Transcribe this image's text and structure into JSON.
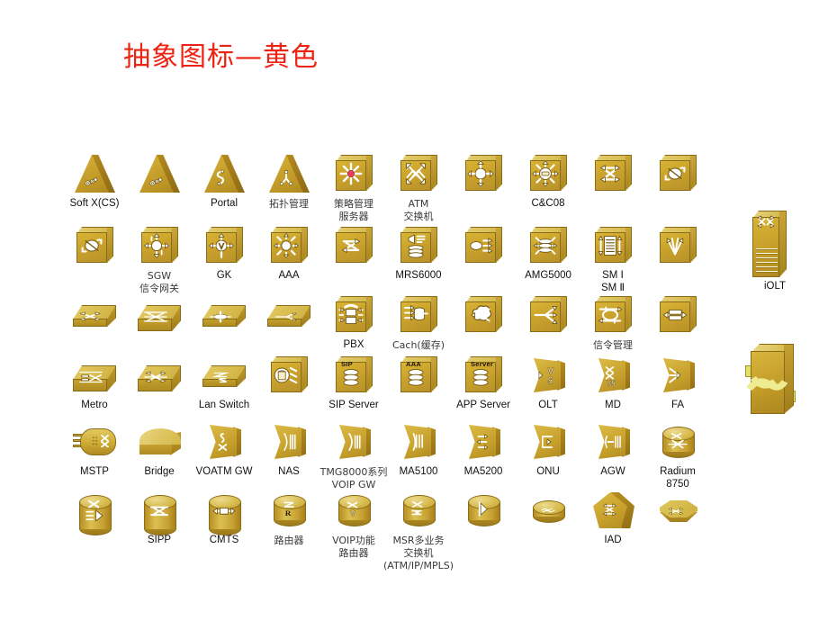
{
  "slide": {
    "title": "抽象图标—黄色",
    "title_color": "#ee2211",
    "background": "#ffffff",
    "palette": {
      "gold_front": "#c8a02b",
      "gold_top": "#e0c85d",
      "gold_side": "#a8811c",
      "outline": "#8a6b18",
      "glyph_white": "#ffffff",
      "accent_pink": "#e8405a",
      "label_text": "#111111"
    }
  },
  "rows": [
    {
      "name": "row-1",
      "icons": [
        {
          "label": "Soft X(CS)",
          "shape": "triangle",
          "glyph": "gears-triangle-icon",
          "cjk": false
        },
        {
          "label": "",
          "shape": "triangle",
          "glyph": "gears-triangle-icon",
          "cjk": false
        },
        {
          "label": "Portal",
          "shape": "triangle",
          "glyph": "portal-s-curve-icon",
          "cjk": false
        },
        {
          "label": "拓扑管理",
          "shape": "triangle",
          "glyph": "topology-tri-node-icon",
          "cjk": true
        },
        {
          "label": "策略管理\n服务器",
          "shape": "cube",
          "glyph": "policy-starburst-icon",
          "cjk": true
        },
        {
          "label": "ATM\n交换机",
          "shape": "cube",
          "glyph": "atm-cross-arrows-icon",
          "cjk": true
        },
        {
          "label": "",
          "shape": "cube",
          "glyph": "ring-four-arrows-icon",
          "cjk": false
        },
        {
          "label": "C&C08",
          "shape": "cube",
          "glyph": "switch-core-arrows-icon",
          "cjk": false
        },
        {
          "label": "",
          "shape": "cube",
          "glyph": "cross-flow-arrows-icon",
          "cjk": false
        },
        {
          "label": "",
          "shape": "cube",
          "glyph": "loop-arrow-icon",
          "cjk": false
        }
      ]
    },
    {
      "name": "row-2",
      "icons": [
        {
          "label": "",
          "shape": "cube",
          "glyph": "loop-arrow-icon",
          "cjk": false
        },
        {
          "label": "SGW\n信令网关",
          "shape": "cube",
          "glyph": "gateway-ring-arrows-icon",
          "cjk": true
        },
        {
          "label": "GK",
          "shape": "cube",
          "glyph": "gatekeeper-v-arrows-icon",
          "cjk": false
        },
        {
          "label": "AAA",
          "shape": "cube",
          "glyph": "aaa-sunburst-icon",
          "cjk": false
        },
        {
          "label": "",
          "shape": "cube",
          "glyph": "double-arrow-exchange-icon",
          "cjk": false
        },
        {
          "label": "MRS6000",
          "shape": "cube",
          "glyph": "media-stack-icon",
          "cjk": false
        },
        {
          "label": "",
          "shape": "cube",
          "glyph": "oval-lines-icon",
          "cjk": false
        },
        {
          "label": "AMG5000",
          "shape": "cube",
          "glyph": "disk-stack-arrows-icon",
          "cjk": false
        },
        {
          "label": "SM Ⅰ\nSM Ⅱ",
          "shape": "cube",
          "glyph": "shelf-module-icon",
          "cjk": false
        },
        {
          "label": "",
          "shape": "cube",
          "glyph": "fan-out-lines-icon",
          "cjk": false
        }
      ]
    },
    {
      "name": "row-3",
      "icons": [
        {
          "label": "",
          "shape": "slab",
          "glyph": "cross-switch-icon",
          "cjk": false
        },
        {
          "label": "",
          "shape": "slab2",
          "glyph": "multi-cross-switch-icon",
          "cjk": false
        },
        {
          "label": "",
          "shape": "slab",
          "glyph": "hub-circle-icon",
          "cjk": false
        },
        {
          "label": "",
          "shape": "slab",
          "glyph": "splitter-icon",
          "cjk": false
        },
        {
          "label": "PBX",
          "shape": "cube",
          "glyph": "telephone-pbx-icon",
          "cjk": false
        },
        {
          "label": "Cach(缓存)",
          "shape": "cube",
          "glyph": "cache-db-arrows-icon",
          "cjk": true
        },
        {
          "label": "",
          "shape": "cube",
          "glyph": "cloud-arrows-icon",
          "cjk": false
        },
        {
          "label": "",
          "shape": "cube",
          "glyph": "multicast-fan-icon",
          "cjk": false
        },
        {
          "label": "信令管理",
          "shape": "cube",
          "glyph": "signalling-loop-icon",
          "cjk": true
        },
        {
          "label": "",
          "shape": "cube",
          "glyph": "bidirectional-stack-icon",
          "cjk": false
        }
      ]
    },
    {
      "name": "row-4",
      "icons": [
        {
          "label": "Metro",
          "shape": "slab2",
          "glyph": "metro-mesh-icon",
          "cjk": false
        },
        {
          "label": "",
          "shape": "slab2",
          "glyph": "four-arrow-switch-icon",
          "cjk": false
        },
        {
          "label": "Lan Switch",
          "shape": "slab",
          "glyph": "lan-switch-xs-icon",
          "cjk": false
        },
        {
          "label": "",
          "shape": "cube",
          "glyph": "server-drum-icon",
          "cjk": false
        },
        {
          "label": "SIP Server",
          "shape": "cube",
          "glyph": "sip-server-icon",
          "chip": "SIP",
          "cjk": false
        },
        {
          "label": "",
          "shape": "cube",
          "glyph": "aaa-server-icon",
          "chip": "AAA",
          "cjk": false
        },
        {
          "label": "APP Server",
          "shape": "cube",
          "glyph": "app-server-icon",
          "chip": "Server",
          "cjk": false
        },
        {
          "label": "OLT",
          "shape": "plate",
          "glyph": "v5-olt-icon",
          "cjk": false
        },
        {
          "label": "MD",
          "shape": "plate",
          "glyph": "md-v5-icon",
          "cjk": false
        },
        {
          "label": "FA",
          "shape": "plate",
          "glyph": "fa-arrows-icon",
          "cjk": false
        }
      ]
    },
    {
      "name": "row-5",
      "icons": [
        {
          "label": "MSTP",
          "shape": "capsule",
          "glyph": "mstp-icon",
          "cjk": false
        },
        {
          "label": "Bridge",
          "shape": "bridge",
          "glyph": "",
          "cjk": false
        },
        {
          "label": "VOATM GW",
          "shape": "plate",
          "glyph": "voatm-gw-icon",
          "cjk": false
        },
        {
          "label": "NAS",
          "shape": "plate",
          "glyph": "nas-bars-icon",
          "cjk": false
        },
        {
          "label": "TMG8000系列\nVOIP GW",
          "shape": "plate",
          "glyph": "tmg-gw-icon",
          "cjk": true
        },
        {
          "label": "MA5100",
          "shape": "plate",
          "glyph": "ma5100-icon",
          "cjk": false
        },
        {
          "label": "MA5200",
          "shape": "plate",
          "glyph": "ma5200-arrows-icon",
          "cjk": false
        },
        {
          "label": "ONU",
          "shape": "plate",
          "glyph": "onu-icon",
          "cjk": false
        },
        {
          "label": "AGW",
          "shape": "plate",
          "glyph": "agw-icon",
          "cjk": false
        },
        {
          "label": "Radium\n8750",
          "shape": "cyl",
          "glyph": "radium-router-icon",
          "cjk": false
        }
      ]
    },
    {
      "name": "row-6",
      "icons": [
        {
          "label": "",
          "shape": "cyl-tall",
          "glyph": "media-router-icon",
          "cjk": false
        },
        {
          "label": "SIPP",
          "shape": "cyl-tall",
          "glyph": "sipp-cross-icon",
          "cjk": false
        },
        {
          "label": "CMTS",
          "shape": "cyl-tall",
          "glyph": "cmts-arrows-icon",
          "cjk": false
        },
        {
          "label": "路由器",
          "shape": "cyl",
          "glyph": "router-r-icon",
          "cjk": true
        },
        {
          "label": "VOIP功能\n路由器",
          "shape": "cyl",
          "glyph": "voip-router-v-icon",
          "cjk": true
        },
        {
          "label": "MSR多业务\n交换机\n(ATM/IP/MPLS)",
          "shape": "cyl",
          "glyph": "msr-switch-icon",
          "cjk": true
        },
        {
          "label": "",
          "shape": "cyl",
          "glyph": "half-flag-icon",
          "cjk": false
        },
        {
          "label": "",
          "shape": "cyl-flat",
          "glyph": "tangle-icon",
          "cjk": false
        },
        {
          "label": "IAD",
          "shape": "pentagon",
          "glyph": "iad-arrows-icon",
          "cjk": false
        },
        {
          "label": "",
          "shape": "octagon",
          "glyph": "oct-cross-icon",
          "cjk": false
        }
      ]
    }
  ],
  "standalone": [
    {
      "label": "iOLT",
      "shape": "tallbox",
      "glyph": "iolt-cabinet-icon",
      "cjk": false
    },
    {
      "label": "",
      "shape": "bigbox",
      "glyph": "swirl-arrows-icon",
      "cjk": false
    }
  ]
}
